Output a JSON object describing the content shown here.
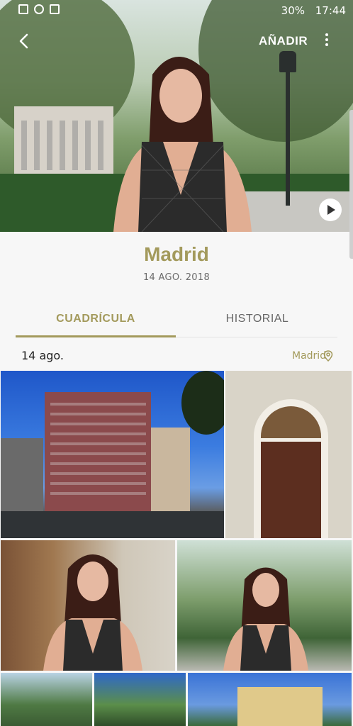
{
  "status_bar": {
    "battery": "30%",
    "time": "17:44"
  },
  "header": {
    "add_label": "AÑADIR"
  },
  "album": {
    "title": "Madrid",
    "date": "14 AGO. 2018"
  },
  "tabs": [
    {
      "label": "CUADRÍCULA",
      "active": true
    },
    {
      "label": "HISTORIAL",
      "active": false
    }
  ],
  "section": {
    "date": "14 ago.",
    "location": "Madrid"
  },
  "colors": {
    "accent": "#a39a5c"
  },
  "icons": {
    "back": "chevron-left-icon",
    "more": "more-vert-icon",
    "play": "play-icon",
    "location": "location-pin-icon"
  }
}
